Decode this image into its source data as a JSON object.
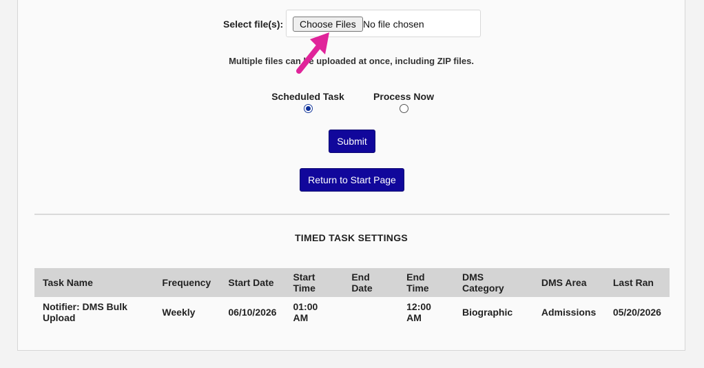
{
  "upload": {
    "label": "Select file(s):",
    "choose_button": "Choose Files",
    "no_file_text": "No file chosen",
    "hint": "Multiple files can be uploaded at once, including ZIP files."
  },
  "mode": {
    "options": [
      {
        "label": "Scheduled Task",
        "checked": true
      },
      {
        "label": "Process Now",
        "checked": false
      }
    ]
  },
  "buttons": {
    "submit": "Submit",
    "return": "Return to Start Page"
  },
  "timed_tasks": {
    "title": "TIMED TASK SETTINGS",
    "headers": [
      "Task Name",
      "Frequency",
      "Start Date",
      "Start Time",
      "End Date",
      "End Time",
      "DMS Category",
      "DMS Area",
      "Last Ran"
    ],
    "rows": [
      [
        "Notifier: DMS Bulk Upload",
        "Weekly",
        "06/10/2026",
        "01:00 AM",
        "",
        "12:00 AM",
        "Biographic",
        "Admissions",
        "05/20/2026"
      ]
    ]
  },
  "colors": {
    "primary_button": "#11079b",
    "annotation_arrow": "#e0249a"
  }
}
